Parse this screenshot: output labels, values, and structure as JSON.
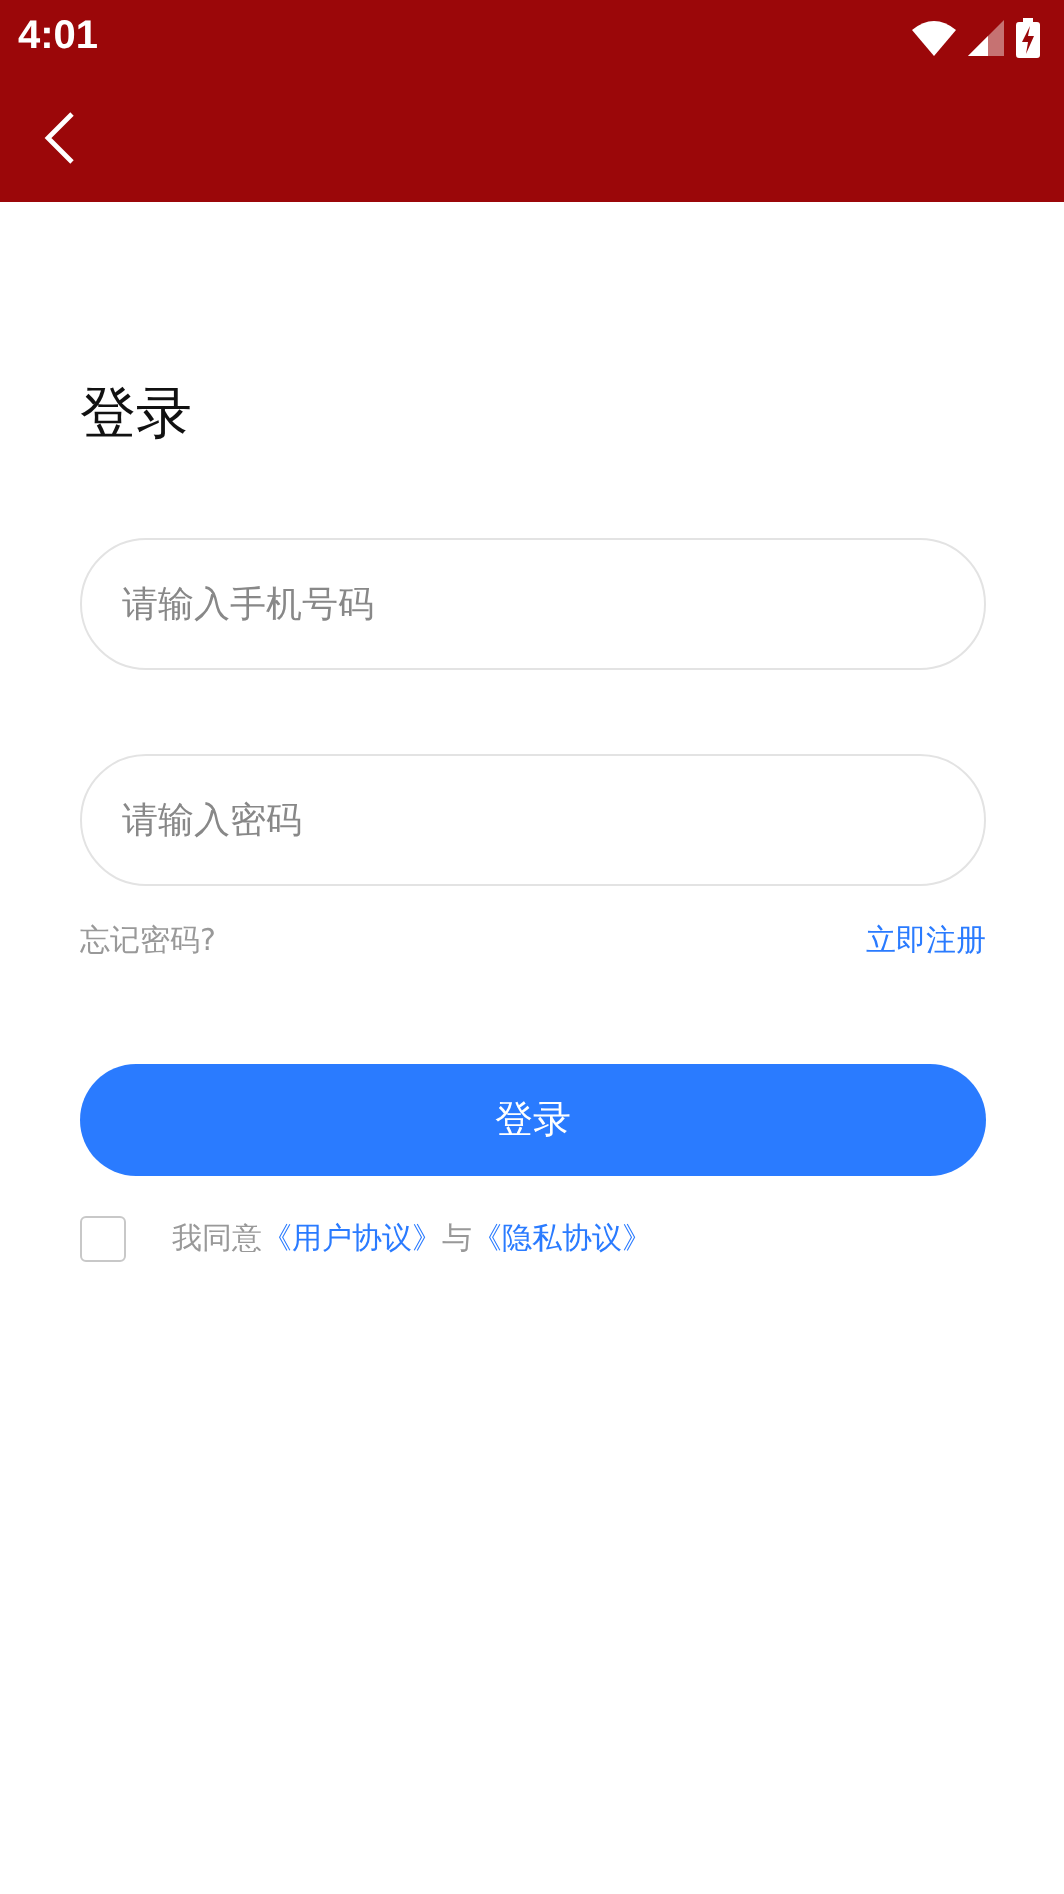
{
  "status_bar": {
    "time": "4:01"
  },
  "title": "登录",
  "fields": [
    {
      "placeholder": "请输入手机号码"
    },
    {
      "placeholder": "请输入密码"
    }
  ],
  "forgot_password": "忘记密码?",
  "register": "立即注册",
  "login_button": "登录",
  "agreement": {
    "checked": false,
    "parts": [
      {
        "kind": "plain",
        "text": "我同意"
      },
      {
        "kind": "link",
        "text": "《用户协议》"
      },
      {
        "kind": "plain",
        "text": "与"
      },
      {
        "kind": "link",
        "text": "《隐私协议》"
      }
    ]
  }
}
